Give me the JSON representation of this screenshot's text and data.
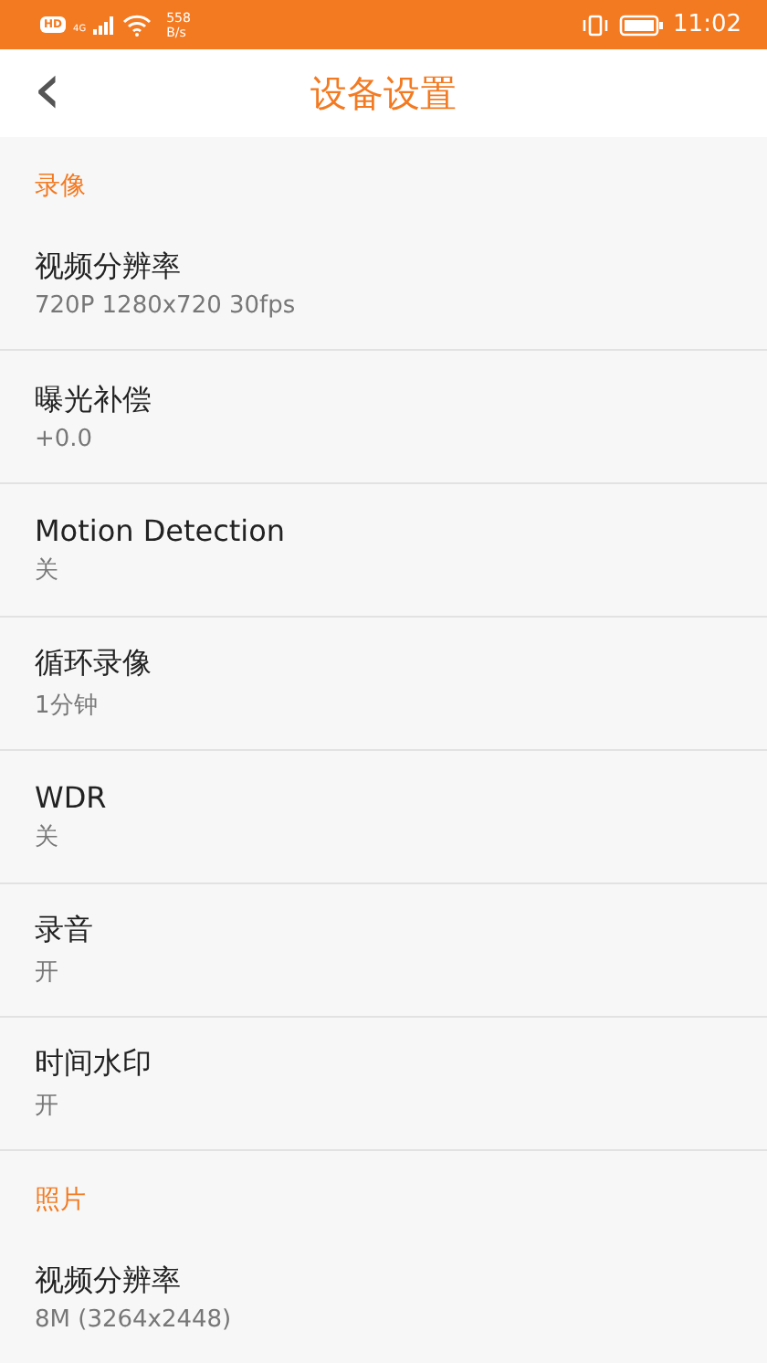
{
  "status_bar": {
    "hd_badge": "HD",
    "network_type": "4G",
    "speed_value": "558",
    "speed_unit": "B/s",
    "time": "11:02"
  },
  "header": {
    "back_icon": "‹",
    "title": "设备设置"
  },
  "sections": [
    {
      "title": "录像",
      "items": [
        {
          "label": "视频分辨率",
          "value": "720P 1280x720 30fps"
        },
        {
          "label": "曝光补偿",
          "value": "+0.0"
        },
        {
          "label": "Motion Detection",
          "value": "关"
        },
        {
          "label": "循环录像",
          "value": "1分钟"
        },
        {
          "label": "WDR",
          "value": "关"
        },
        {
          "label": "录音",
          "value": "开"
        },
        {
          "label": "时间水印",
          "value": "开"
        }
      ]
    },
    {
      "title": "照片",
      "items": [
        {
          "label": "视频分辨率",
          "value": "8M (3264x2448)"
        }
      ]
    }
  ]
}
